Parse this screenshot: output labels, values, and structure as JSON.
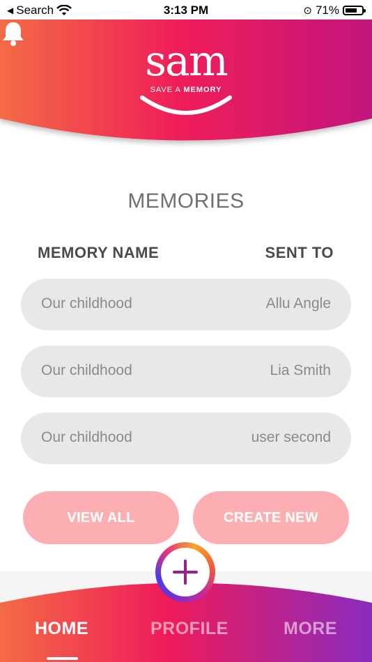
{
  "status_bar": {
    "back_label": "Search",
    "time": "3:13 PM",
    "battery_percent": "71%",
    "battery_level": 0.71
  },
  "header": {
    "logo_text": "sam",
    "tagline_light": "SAVE A ",
    "tagline_bold": "MEMORY",
    "bell_icon": "bell-icon"
  },
  "main": {
    "title": "MEMORIES",
    "columns": {
      "name": "MEMORY NAME",
      "sent_to": "SENT TO"
    },
    "memories": [
      {
        "name": "Our childhood",
        "sent_to": "Allu Angle"
      },
      {
        "name": "Our childhood",
        "sent_to": "Lia Smith"
      },
      {
        "name": "Our childhood",
        "sent_to": "user second"
      }
    ],
    "buttons": {
      "view_all": "VIEW ALL",
      "create_new": "CREATE NEW"
    }
  },
  "bottom_nav": {
    "items": [
      {
        "label": "HOME",
        "active": true
      },
      {
        "label": "PROFILE",
        "active": false
      },
      {
        "label": "MORE",
        "active": false
      }
    ],
    "fab_icon": "plus-icon"
  },
  "colors": {
    "header_gradient": [
      "#f46b45",
      "#ee1b5a",
      "#c2187e"
    ],
    "button_bg": "#fdaeb2",
    "row_bg": "#e8e8e8"
  }
}
